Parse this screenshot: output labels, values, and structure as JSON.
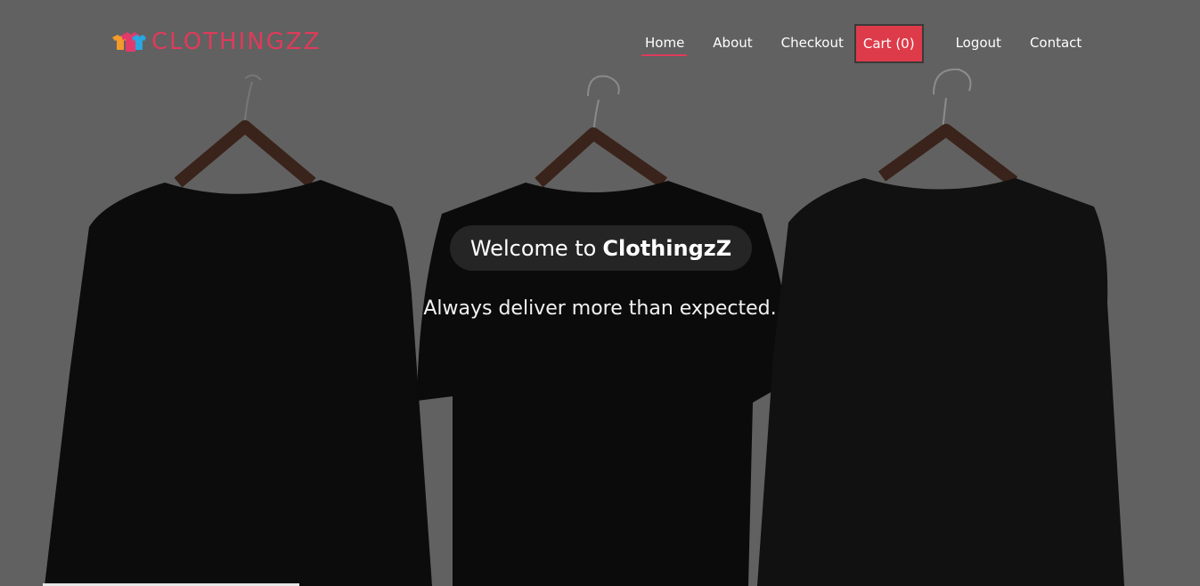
{
  "brand": {
    "name": "CLOTHINGZZ",
    "icon": "shirts-logo-icon"
  },
  "nav": {
    "home": "Home",
    "about": "About",
    "checkout": "Checkout",
    "cart": "Cart (0)",
    "logout": "Logout",
    "contact": "Contact",
    "active": "Home"
  },
  "hero": {
    "welcome_prefix": "Welcome to",
    "welcome_brand": "ClothingzZ",
    "tagline": "Always deliver more than expected."
  },
  "colors": {
    "accent": "#de3b5a",
    "cart_bg": "#de3b4a",
    "overlay": "#616161"
  }
}
